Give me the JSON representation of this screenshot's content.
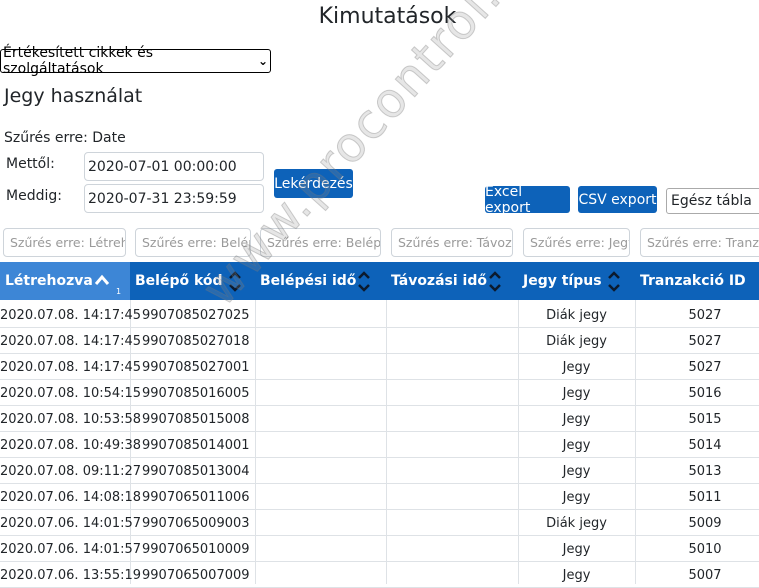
{
  "header": {
    "title": "Kimutatások"
  },
  "report_select": {
    "value": "Értékesített cikkek és szolgáltatások"
  },
  "section": {
    "title": "Jegy használat"
  },
  "filters": {
    "filter_by": "Szűrés erre: Date",
    "from_label": "Mettől:",
    "from_value": "2020-07-01 00:00:00",
    "to_label": "Meddig:",
    "to_value": "2020-07-31 23:59:59",
    "query_button": "Lekérdezés"
  },
  "export": {
    "excel_button": "Excel export",
    "csv_button": "CSV export",
    "scope_value": "Egész tábla"
  },
  "column_filters": [
    "Szűrés erre: Létrehozva",
    "Szűrés erre: Belépő kód",
    "Szűrés erre: Belépési idő",
    "Szűrés erre: Távozási idő",
    "Szűrés erre: Jegy típus",
    "Szűrés erre: Tranzakció ID"
  ],
  "table": {
    "columns": [
      "Létrehozva",
      "Belépő kód",
      "Belépési idő",
      "Távozási idő",
      "Jegy típus",
      "Tranzakció ID"
    ],
    "sort_index": "1",
    "rows": [
      [
        "2020.07.08. 14:17:45",
        "9907085027025",
        "",
        "",
        "Diák jegy",
        "5027"
      ],
      [
        "2020.07.08. 14:17:45",
        "9907085027018",
        "",
        "",
        "Diák jegy",
        "5027"
      ],
      [
        "2020.07.08. 14:17:45",
        "9907085027001",
        "",
        "",
        "Jegy",
        "5027"
      ],
      [
        "2020.07.08. 10:54:15",
        "9907085016005",
        "",
        "",
        "Jegy",
        "5016"
      ],
      [
        "2020.07.08. 10:53:58",
        "9907085015008",
        "",
        "",
        "Jegy",
        "5015"
      ],
      [
        "2020.07.08. 10:49:38",
        "9907085014001",
        "",
        "",
        "Jegy",
        "5014"
      ],
      [
        "2020.07.08. 09:11:27",
        "9907085013004",
        "",
        "",
        "Jegy",
        "5013"
      ],
      [
        "2020.07.06. 14:08:18",
        "9907065011006",
        "",
        "",
        "Jegy",
        "5011"
      ],
      [
        "2020.07.06. 14:01:57",
        "9907065009003",
        "",
        "",
        "Diák jegy",
        "5009"
      ],
      [
        "2020.07.06. 14:01:57",
        "9907065010009",
        "",
        "",
        "Jegy",
        "5010"
      ],
      [
        "2020.07.06. 13:55:19",
        "9907065007009",
        "",
        "",
        "Jegy",
        "5007"
      ]
    ]
  },
  "watermark": {
    "text": "www.procontrol.hu"
  },
  "colors": {
    "accent": "#0d62b9",
    "sorted_header": "#3d86d6"
  }
}
